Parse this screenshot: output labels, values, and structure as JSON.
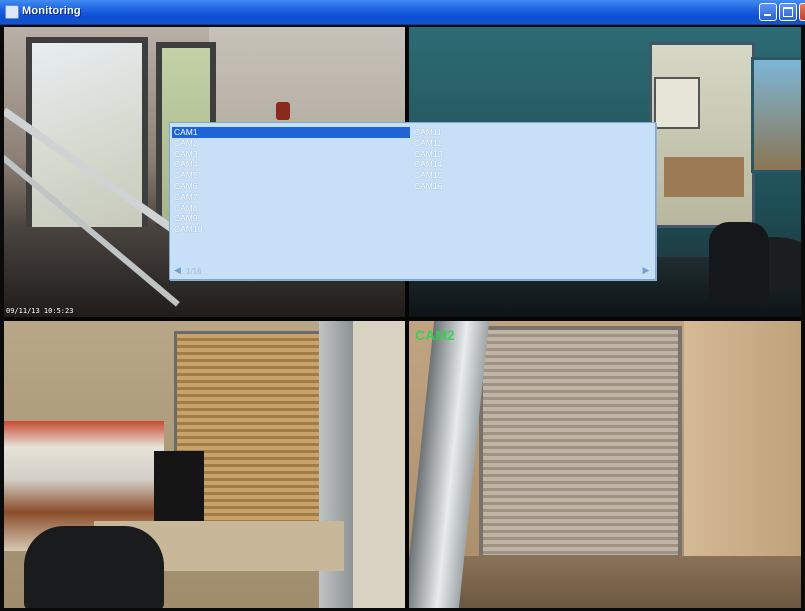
{
  "window": {
    "title": "Monitoring",
    "icon": "camera-app-icon",
    "buttons": [
      "minimize",
      "maximize",
      "close"
    ]
  },
  "cameras": [
    {
      "label": "",
      "timestamp": "09/11/13 10:5:23"
    },
    {
      "label": ""
    },
    {
      "label": ""
    },
    {
      "label": "CAM2"
    }
  ],
  "camera_list": {
    "left_column": [
      "CAM1",
      "CAM2",
      "CAM3",
      "CAM4",
      "CAM5",
      "CAM6",
      "CAM7",
      "CAM8",
      "CAM9",
      "CAM10"
    ],
    "right_column": [
      "CAM11",
      "CAM12",
      "CAM13",
      "CAM14",
      "CAM15",
      "CAM16"
    ],
    "selected": "CAM1",
    "status_text": "1/16"
  },
  "colors": {
    "titlebar": "#0a4fd6",
    "list_bg": "#c7e0f7",
    "selection": "#1e64d6",
    "cam_label": "#29d64a"
  }
}
